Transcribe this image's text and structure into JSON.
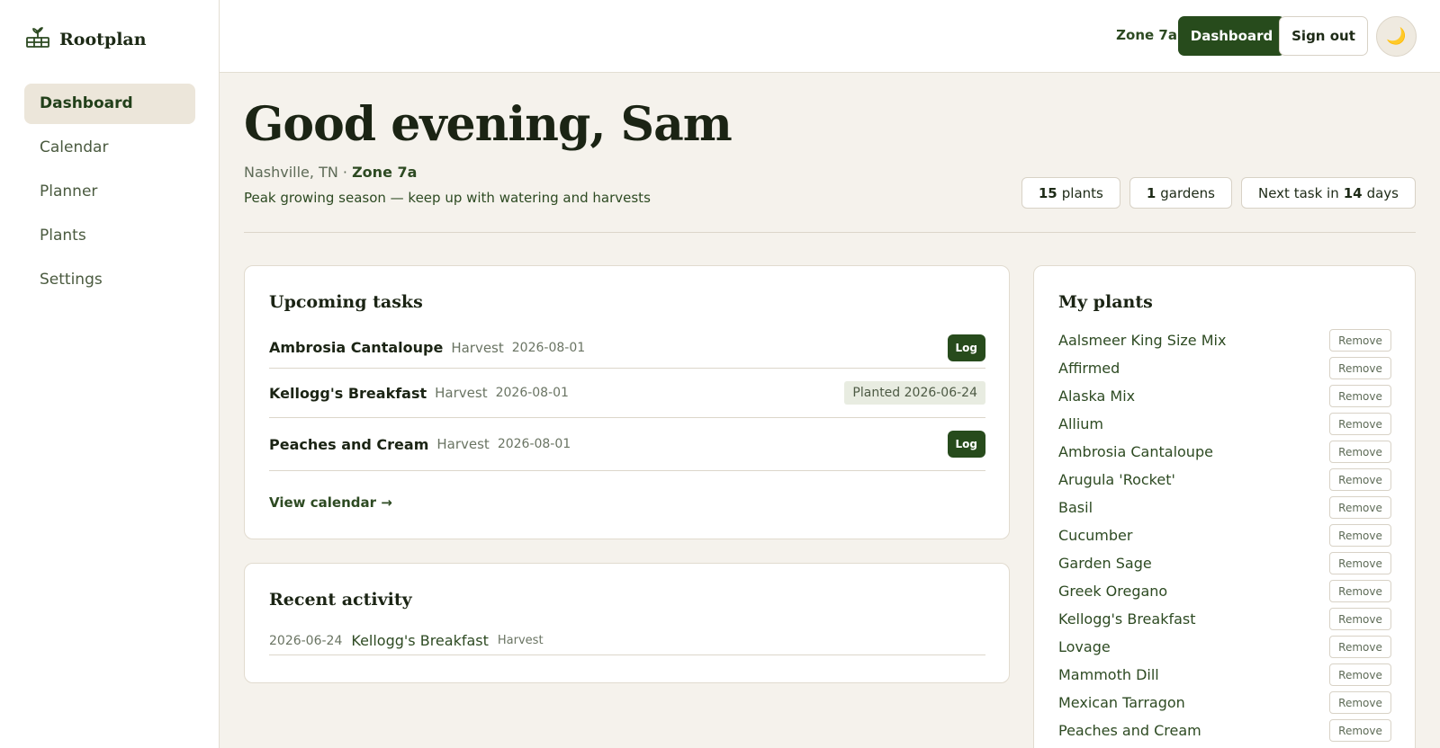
{
  "brand": {
    "name": "Rootplan",
    "icon": "planter-box-icon"
  },
  "sidebar": {
    "items": [
      {
        "label": "Dashboard",
        "active": true
      },
      {
        "label": "Calendar"
      },
      {
        "label": "Planner"
      },
      {
        "label": "Plants"
      },
      {
        "label": "Settings"
      }
    ]
  },
  "header": {
    "zone": "Zone 7a",
    "dashboard_label": "Dashboard",
    "signout_label": "Sign out",
    "theme_icon": "moon-icon",
    "theme_glyph": "🌙"
  },
  "hero": {
    "greeting": "Good evening, Sam",
    "location": "Nashville, TN",
    "separator": " · ",
    "zone": "Zone 7a",
    "season_message": "Peak growing season — keep up with watering and harvests"
  },
  "stats": {
    "plants_count": "15",
    "plants_label": "plants",
    "gardens_count": "1",
    "gardens_label": "gardens",
    "next_task_prefix": "Next task in",
    "next_task_days": "14",
    "next_task_suffix": "days"
  },
  "tasks": {
    "title": "Upcoming tasks",
    "items": [
      {
        "plant": "Ambrosia Cantaloupe",
        "type": "Harvest",
        "date": "2026-08-01",
        "action": "Log"
      },
      {
        "plant": "Kellogg's Breakfast",
        "type": "Harvest",
        "date": "2026-08-01",
        "badge": "Planted 2026-06-24"
      },
      {
        "plant": "Peaches and Cream",
        "type": "Harvest",
        "date": "2026-08-01",
        "action": "Log"
      }
    ],
    "view_calendar": "View calendar →"
  },
  "activity": {
    "title": "Recent activity",
    "items": [
      {
        "date": "2026-06-24",
        "plant": "Kellogg's Breakfast",
        "type": "Harvest"
      }
    ]
  },
  "plants": {
    "title": "My plants",
    "remove_label": "Remove",
    "items": [
      "Aalsmeer King Size Mix",
      "Affirmed",
      "Alaska Mix",
      "Allium",
      "Ambrosia Cantaloupe",
      "Arugula 'Rocket'",
      "Basil",
      "Cucumber",
      "Garden Sage",
      "Greek Oregano",
      "Kellogg's Breakfast",
      "Lovage",
      "Mammoth Dill",
      "Mexican Tarragon",
      "Peaches and Cream"
    ]
  },
  "colors": {
    "accent": "#274b1c",
    "background": "#f5f2ec",
    "text": "#1b2414"
  }
}
